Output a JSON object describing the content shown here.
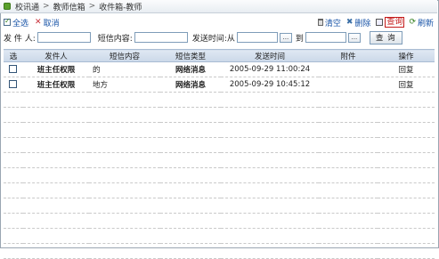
{
  "breadcrumb": [
    "校讯通",
    "教师信箱",
    "收件箱-教师"
  ],
  "toolbar": {
    "select_all": "全选",
    "cancel": "取消",
    "clear": "清空",
    "delete": "删除",
    "query": "查询",
    "refresh": "刷新"
  },
  "search": {
    "sender_label": "发 件 人:",
    "sender_value": "",
    "content_label": "短信内容:",
    "content_value": "",
    "time_label": "发送时间:从",
    "from_value": "",
    "to_label": "到",
    "to_value": "",
    "picker_label": "...",
    "query_button": "查 询"
  },
  "table": {
    "headers": [
      "选",
      "发件人",
      "短信内容",
      "短信类型",
      "发送时间",
      "附件",
      "操作"
    ],
    "rows": [
      {
        "sender": "班主任权限",
        "content": "的",
        "type": "网络消息",
        "time": "2005-09-29 11:00:24",
        "attachment": "",
        "action": "回复"
      },
      {
        "sender": "班主任权限",
        "content": "地方",
        "type": "网络消息",
        "time": "2005-09-29 10:45:12",
        "attachment": "",
        "action": "回复"
      }
    ]
  }
}
